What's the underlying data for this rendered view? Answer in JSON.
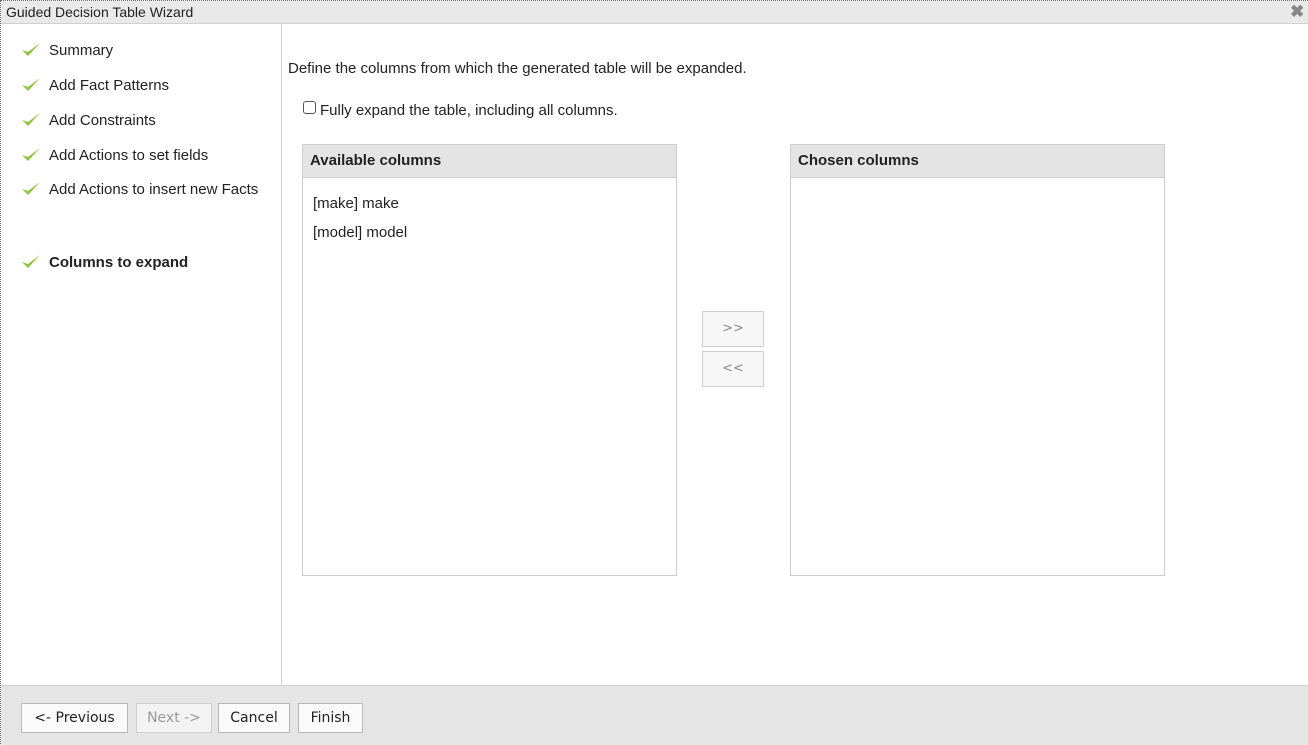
{
  "dialog": {
    "title": "Guided Decision Table Wizard",
    "close_icon": "close-icon"
  },
  "steps": [
    {
      "label": "Summary",
      "complete": true
    },
    {
      "label": "Add Fact Patterns",
      "complete": true
    },
    {
      "label": "Add Constraints",
      "complete": true
    },
    {
      "label": "Add Actions to set fields",
      "complete": true
    },
    {
      "label": "Add Actions to insert new Facts",
      "complete": true
    },
    {
      "label": "Columns to expand",
      "complete": true,
      "current": true
    }
  ],
  "content": {
    "intro": "Define the columns from which the generated table will be expanded.",
    "fully_expand": {
      "label": "Fully expand the table, including all columns.",
      "checked": false
    },
    "available": {
      "header": "Available columns",
      "items": [
        "[make] make",
        "[model] model"
      ]
    },
    "chosen": {
      "header": "Chosen columns",
      "items": []
    },
    "add_button": ">>",
    "remove_button": "<<"
  },
  "footer": {
    "previous": "<- Previous",
    "next": "Next ->",
    "cancel": "Cancel",
    "finish": "Finish"
  },
  "colors": {
    "check": "#8cc43c",
    "titlebar": "#e9e9e9",
    "footer": "#e5e5e5"
  }
}
